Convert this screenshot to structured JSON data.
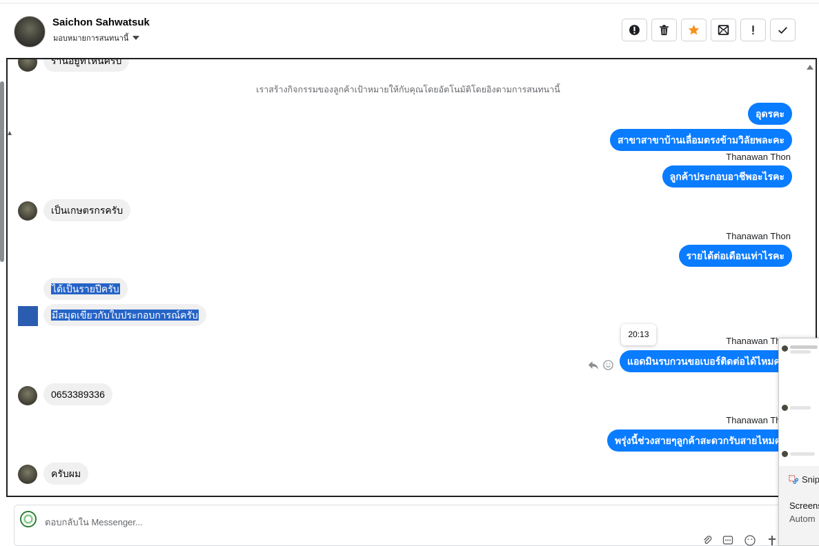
{
  "header": {
    "contact_name": "Saichon Sahwatsuk",
    "assign_label": "มอบหมายการสนทนานี้",
    "actions": [
      {
        "name": "spam-icon"
      },
      {
        "name": "trash-icon"
      },
      {
        "name": "star-icon",
        "color": "#f7931e"
      },
      {
        "name": "mark-unread-icon"
      },
      {
        "name": "follow-up-icon"
      },
      {
        "name": "done-check-icon"
      }
    ]
  },
  "conversation": {
    "partial_top_message": "ร้านอยู่ที่ไหนครับ",
    "system_message": "เราสร้างกิจกรรมของลูกค้าเป้าหมายให้กับคุณโดยอัตโนมัติโดยอิงตามการสนทนานี้",
    "messages": [
      {
        "text": "อุดรคะ"
      },
      {
        "text": "สาขาสาขาบ้านเลื่อมตรงข้ามวิลัยพละคะ"
      },
      {
        "sender": "Thanawan Thon",
        "text": "ลูกค้าประกอบอาชีพอะไรคะ"
      },
      {
        "text": "เป็นเกษตรกรครับ"
      },
      {
        "sender": "Thanawan Thon",
        "text": "รายได้ต่อเดือนเท่าไรคะ"
      },
      {
        "text": "ได้เป็นรายปีครับ"
      },
      {
        "text": "มีสมุดเขียวกับใบประกอบการณ์ครับ"
      },
      {
        "tooltip": "20:13",
        "sender": "Thanawan Thon",
        "text": "แอดมินรบกวนขอเบอร์ติดต่อได้ไหมคะ"
      },
      {
        "text": "0653389336"
      },
      {
        "sender": "Thanawan Thon",
        "text": "พรุ่งนี้ช่วงสายๆลูกค้าสะดวกรับสายไหมคะ"
      },
      {
        "text": "ครับผม"
      }
    ],
    "accent_color": "#0a7cff"
  },
  "composer": {
    "placeholder": "ตอบกลับใน Messenger..."
  },
  "snip_popup": {
    "app_name": "Snip",
    "line1": "Screens",
    "line2": "Autom"
  }
}
